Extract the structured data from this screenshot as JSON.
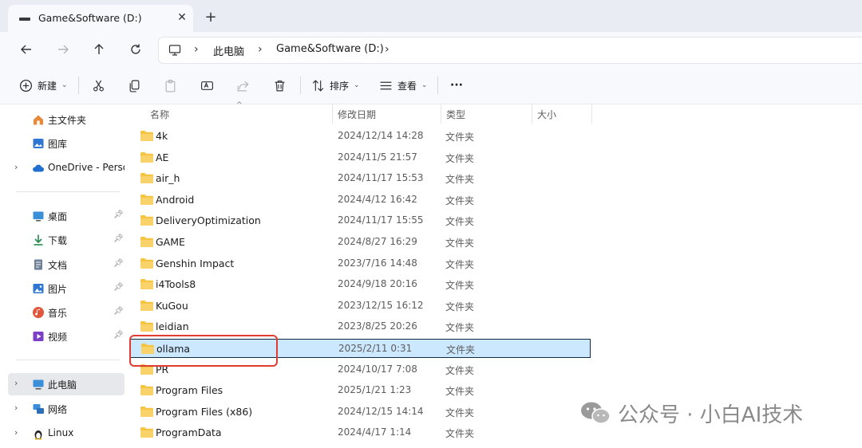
{
  "window": {
    "tab_title": "Game&Software (D:)",
    "tab_close": "✕",
    "new_tab": "+"
  },
  "address": {
    "crumbs": [
      "此电脑",
      "Game&Software (D:)"
    ],
    "sep": "›"
  },
  "toolbar": {
    "new_label": "新建",
    "sort_label": "排序",
    "view_label": "查看",
    "more_label": "···"
  },
  "sidebar": {
    "items": [
      {
        "label": "主文件夹",
        "icon": "home-icon"
      },
      {
        "label": "图库",
        "icon": "gallery-icon"
      },
      {
        "label": "OneDrive - Perso",
        "icon": "cloud-icon"
      },
      {
        "label": "桌面",
        "icon": "desktop-icon"
      },
      {
        "label": "下载",
        "icon": "download-icon"
      },
      {
        "label": "文档",
        "icon": "documents-icon"
      },
      {
        "label": "图片",
        "icon": "pictures-icon"
      },
      {
        "label": "音乐",
        "icon": "music-icon"
      },
      {
        "label": "视频",
        "icon": "videos-icon"
      },
      {
        "label": "此电脑",
        "icon": "this-pc-icon"
      },
      {
        "label": "网络",
        "icon": "network-icon"
      },
      {
        "label": "Linux",
        "icon": "linux-icon"
      }
    ]
  },
  "columns": {
    "name": "名称",
    "modified": "修改日期",
    "type": "类型",
    "size": "大小"
  },
  "files": [
    {
      "name": "4k",
      "modified": "2024/12/14 14:28",
      "type": "文件夹"
    },
    {
      "name": "AE",
      "modified": "2024/11/5 21:57",
      "type": "文件夹"
    },
    {
      "name": "air_h",
      "modified": "2024/11/17 15:53",
      "type": "文件夹"
    },
    {
      "name": "Android",
      "modified": "2024/4/12 16:42",
      "type": "文件夹"
    },
    {
      "name": "DeliveryOptimization",
      "modified": "2024/11/17 15:55",
      "type": "文件夹"
    },
    {
      "name": "GAME",
      "modified": "2024/8/27 16:29",
      "type": "文件夹"
    },
    {
      "name": "Genshin Impact",
      "modified": "2023/7/16 14:48",
      "type": "文件夹"
    },
    {
      "name": "i4Tools8",
      "modified": "2024/9/18 20:16",
      "type": "文件夹"
    },
    {
      "name": "KuGou",
      "modified": "2023/12/15 16:12",
      "type": "文件夹"
    },
    {
      "name": "leidian",
      "modified": "2023/8/25 20:26",
      "type": "文件夹"
    },
    {
      "name": "ollama",
      "modified": "2025/2/11 0:31",
      "type": "文件夹",
      "selected": true
    },
    {
      "name": "PR",
      "modified": "2024/10/17 7:08",
      "type": "文件夹"
    },
    {
      "name": "Program Files",
      "modified": "2025/1/21 1:23",
      "type": "文件夹"
    },
    {
      "name": "Program Files (x86)",
      "modified": "2024/12/15 14:14",
      "type": "文件夹"
    },
    {
      "name": "ProgramData",
      "modified": "2024/4/17 1:14",
      "type": "文件夹"
    }
  ],
  "watermark": {
    "text": "公众号 · 小白AI技术"
  },
  "colors": {
    "folder": "#f6c443",
    "selection_bg": "#cce8ff",
    "highlight_box": "#e03c31"
  }
}
